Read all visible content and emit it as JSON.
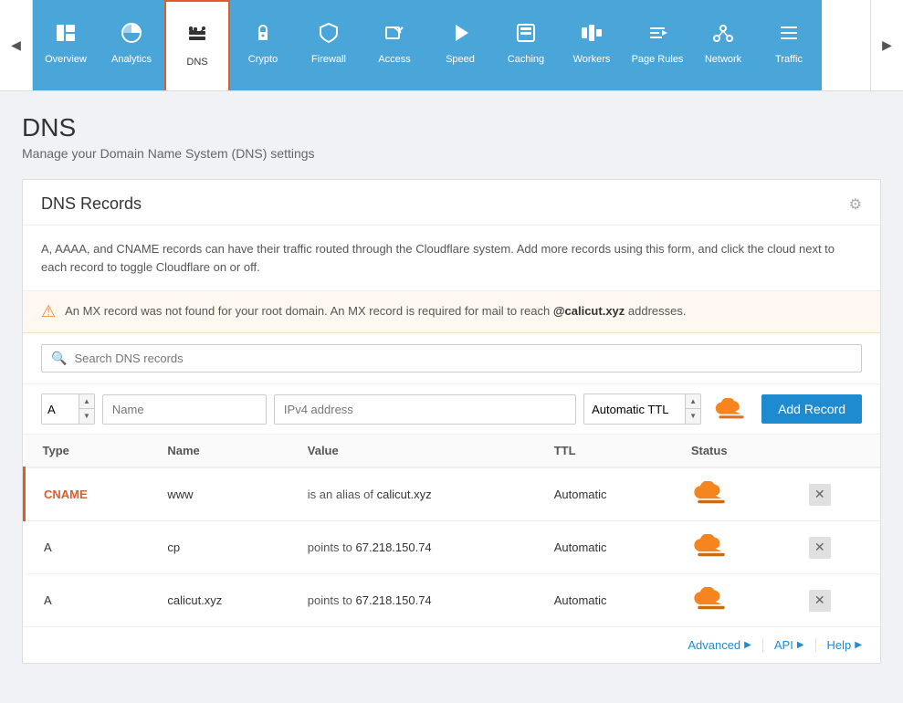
{
  "nav": {
    "items": [
      {
        "id": "overview",
        "label": "Overview",
        "icon": "📋",
        "active": false
      },
      {
        "id": "analytics",
        "label": "Analytics",
        "icon": "📊",
        "active": false
      },
      {
        "id": "dns",
        "label": "DNS",
        "icon": "🔀",
        "active": true
      },
      {
        "id": "crypto",
        "label": "Crypto",
        "icon": "🔒",
        "active": false
      },
      {
        "id": "firewall",
        "label": "Firewall",
        "icon": "🛡",
        "active": false
      },
      {
        "id": "access",
        "label": "Access",
        "icon": "📤",
        "active": false
      },
      {
        "id": "speed",
        "label": "Speed",
        "icon": "⚡",
        "active": false
      },
      {
        "id": "caching",
        "label": "Caching",
        "icon": "🖥",
        "active": false
      },
      {
        "id": "workers",
        "label": "Workers",
        "icon": "⚙",
        "active": false
      },
      {
        "id": "pagerules",
        "label": "Page Rules",
        "icon": "🔽",
        "active": false
      },
      {
        "id": "network",
        "label": "Network",
        "icon": "📍",
        "active": false
      },
      {
        "id": "traffic",
        "label": "Traffic",
        "icon": "☰",
        "active": false
      }
    ],
    "left_arrow": "◀",
    "right_arrow": "▶"
  },
  "page": {
    "title": "DNS",
    "subtitle": "Manage your Domain Name System (DNS) settings"
  },
  "card": {
    "title": "DNS Records",
    "desc": "A, AAAA, and CNAME records can have their traffic routed through the Cloudflare system. Add more records using this form, and click the cloud next to each record to toggle Cloudflare on or off.",
    "warning": {
      "text_before": "An MX record was not found for your root domain. An MX record is required for mail to reach ",
      "domain": "@calicut.xyz",
      "text_after": " addresses."
    },
    "search_placeholder": "Search DNS records",
    "add_record": {
      "type_value": "A",
      "name_placeholder": "Name",
      "value_placeholder": "IPv4 address",
      "ttl_value": "Automatic TTL",
      "btn_label": "Add Record"
    },
    "table": {
      "headers": [
        "Type",
        "Name",
        "Value",
        "TTL",
        "Status"
      ],
      "rows": [
        {
          "type": "CNAME",
          "type_color": "orange",
          "name": "www",
          "value_prefix": "is an alias of ",
          "value_main": "calicut.xyz",
          "ttl": "Automatic",
          "cloud_active": true
        },
        {
          "type": "A",
          "type_color": "default",
          "name": "cp",
          "value_prefix": "points to ",
          "value_main": "67.218.150.74",
          "ttl": "Automatic",
          "cloud_active": true
        },
        {
          "type": "A",
          "type_color": "default",
          "name": "calicut.xyz",
          "value_prefix": "points to ",
          "value_main": "67.218.150.74",
          "ttl": "Automatic",
          "cloud_active": true
        }
      ]
    },
    "footer": {
      "links": [
        {
          "label": "Advanced",
          "arrow": "▶"
        },
        {
          "label": "API",
          "arrow": "▶"
        },
        {
          "label": "Help",
          "arrow": "▶"
        }
      ]
    }
  }
}
